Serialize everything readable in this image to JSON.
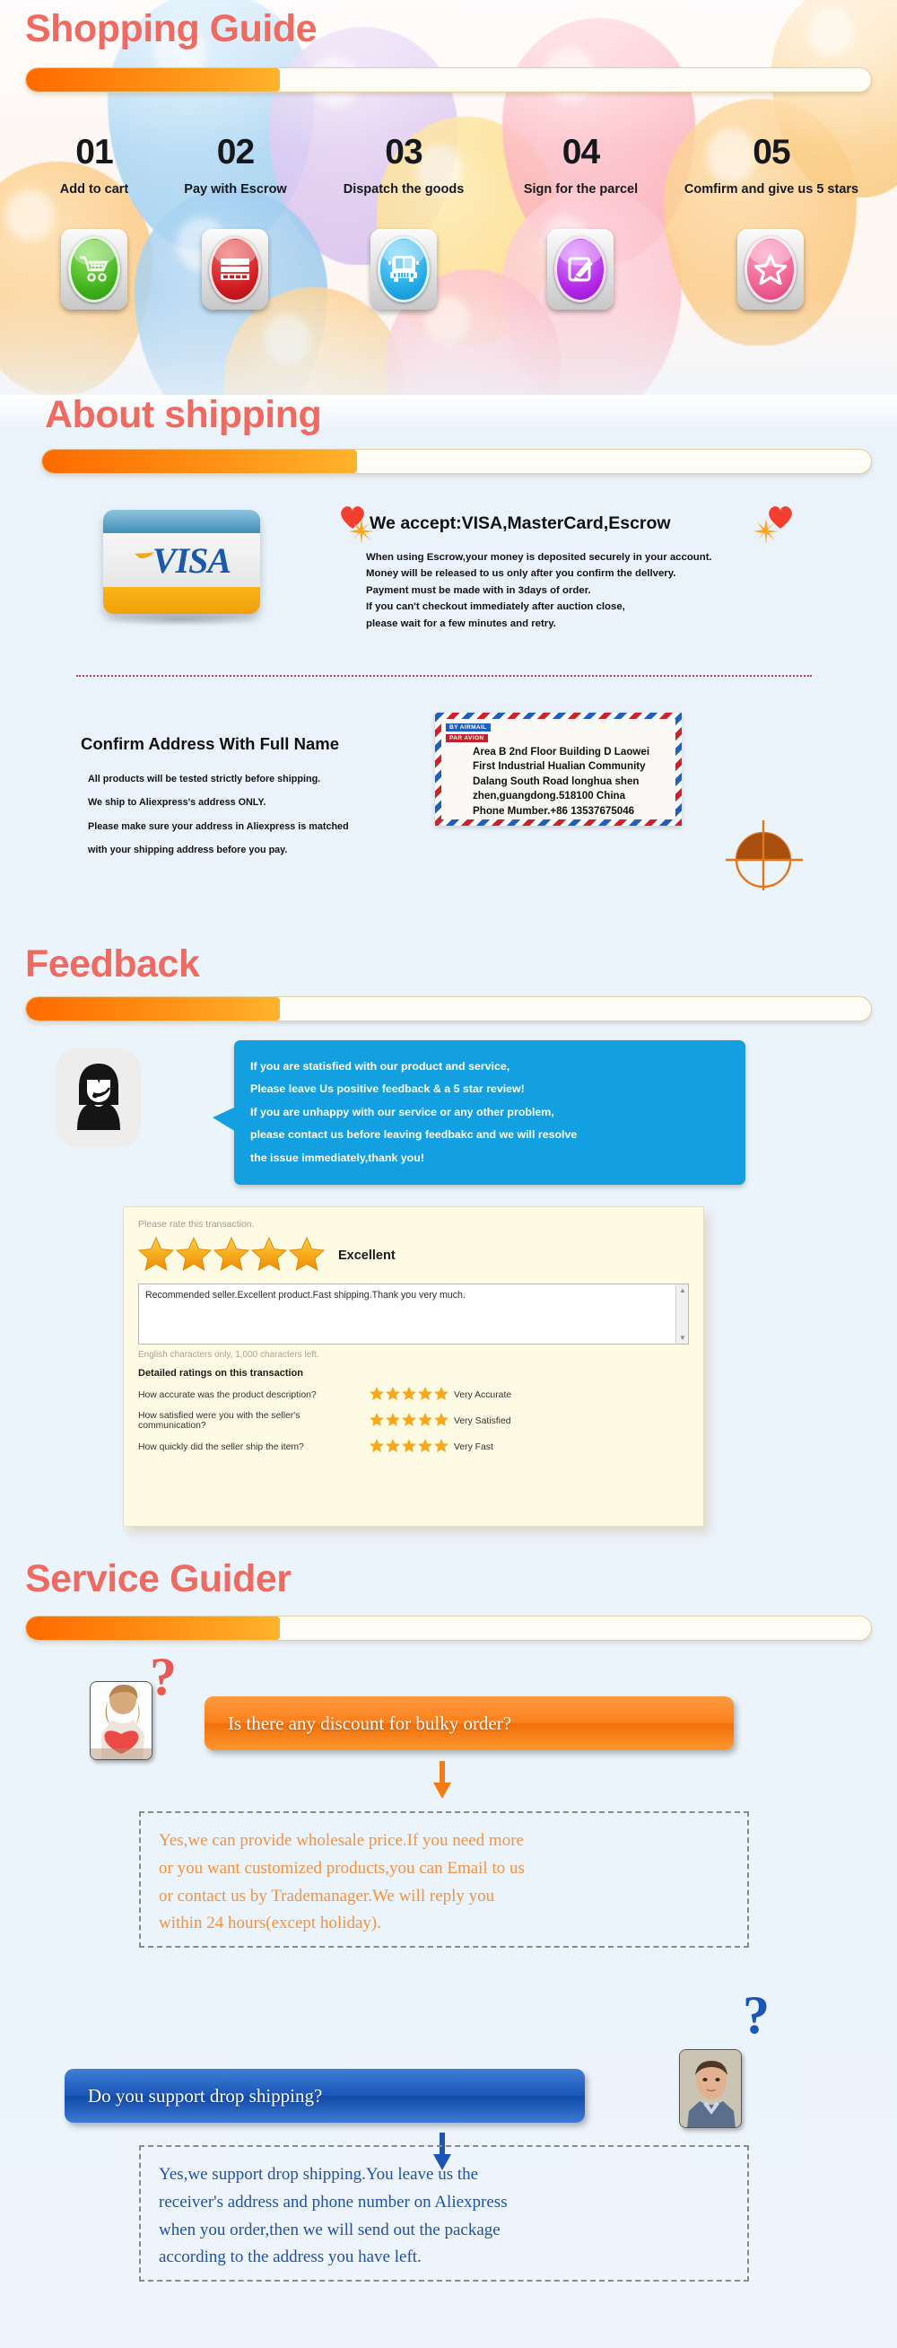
{
  "sections": {
    "shopping_guide": {
      "title": "Shopping Guide",
      "progress_pct": 30,
      "steps": [
        {
          "num": "01",
          "label": "Add to cart",
          "icon": "shopping-cart-icon",
          "color": "#3fb11c"
        },
        {
          "num": "02",
          "label": "Pay with Escrow",
          "icon": "credit-card-icon",
          "color": "#cf1c21"
        },
        {
          "num": "03",
          "label": "Dispatch the goods",
          "icon": "delivery-truck-icon",
          "color": "#22aae6"
        },
        {
          "num": "04",
          "label": "Sign for the parcel",
          "icon": "sign-document-icon",
          "color": "#b327e8"
        },
        {
          "num": "05",
          "label": "Comfirm and give us 5 stars",
          "icon": "star-icon",
          "color": "#ef5f92"
        }
      ]
    },
    "about_shipping": {
      "title": "About shipping",
      "progress_pct": 38,
      "card_brand": "VISA",
      "accept_heading": "We accept:VISA,MasterCard,Escrow",
      "accept_lines": [
        "When using Escrow,your money is deposited securely in your account.",
        "Money will be released to us only after you confirm the dellvery.",
        "Payment must be made with in 3days of order.",
        "If you can't checkout immediately after auction close,",
        "please wait for a few minutes and retry."
      ]
    },
    "confirm_address": {
      "title": "Confirm Address With Full Name",
      "lines": [
        "All products will be tested strictly before shipping.",
        "We ship to Aliexpress's address ONLY.",
        "Please make sure your address in Aliexpress is matched",
        "with your shipping address before you pay."
      ],
      "envelope": {
        "tag_airmail": "BY AIRMAIL",
        "tag_paravion": "PAR AVION",
        "address_lines": [
          "Area B 2nd Floor Building D Laowei",
          "First Industrial Hualian Community",
          "Dalang South Road longhua shen",
          "zhen,guangdong.518100  China",
          "Phone Mumber.+86 13537675046"
        ]
      }
    },
    "feedback": {
      "title": "Feedback",
      "progress_pct": 30,
      "bubble_lines": [
        "If you are statisfied with our product and service,",
        "Please leave Us positive feedback & a 5 star review!",
        "If you are unhappy with our service or any other problem,",
        "please contact us before leaving feedbakc and we will resolve",
        "the issue immediately,thank you!"
      ],
      "rating_card": {
        "hint": "Please rate this transaction.",
        "stars": 5,
        "rating_word": "Excellent",
        "review_text": "Recommended seller.Excellent product.Fast shipping.Thank you very much.",
        "chars_note": "English characters only, 1,000 characters left.",
        "detail_title": "Detailed ratings on this transaction",
        "detail_rows": [
          {
            "question": "How accurate was the product description?",
            "stars": 5,
            "answer": "Very Accurate"
          },
          {
            "question": "How satisfied were you with the seller's communication?",
            "stars": 5,
            "answer": "Very Satisfied"
          },
          {
            "question": "How quickly did the seller ship the item?",
            "stars": 5,
            "answer": "Very Fast"
          }
        ]
      }
    },
    "service_guider": {
      "title": "Service Guider",
      "progress_pct": 30,
      "qa": [
        {
          "question": "Is there any discount for bulky order?",
          "question_color": "#f57c13",
          "answer_lines": [
            "Yes,we can provide wholesale price.If you need more",
            "or you want customized products,you can Email to us",
            "or contact us by Trademanager.We will reply you",
            "within 24 hours(except holiday)."
          ],
          "answer_color": "#f6913f",
          "avatar": "woman-with-heart-photo",
          "qmark_color": "#ea5a52"
        },
        {
          "question": "Do you support drop shipping?",
          "question_color": "#1b55b8",
          "answer_lines": [
            "Yes,we support drop shipping.You leave us the",
            "receiver's address and phone number on Aliexpress",
            " when you order,then we will send out the package",
            " according to the address you have left."
          ],
          "answer_color": "#1f52a8",
          "avatar": "man-portrait-photo",
          "qmark_color": "#1b55b8"
        }
      ]
    }
  },
  "colors": {
    "heading": "#ef6b62",
    "bar_fill_start": "#ff6a00",
    "bar_fill_end": "#ffb32b",
    "bubble_blue": "#13a0e0",
    "star_gold": "#f7a91b"
  }
}
